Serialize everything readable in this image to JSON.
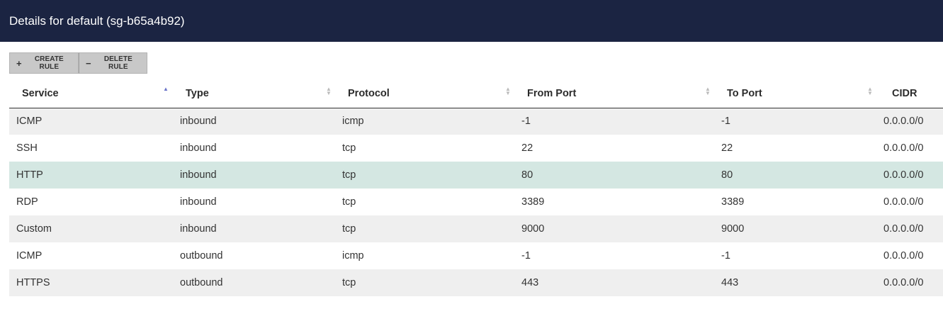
{
  "header": {
    "title": "Details for default (sg-b65a4b92)"
  },
  "toolbar": {
    "create_label": "Create Rule",
    "create_icon": "plus-icon",
    "delete_label": "Delete Rule",
    "delete_icon": "minus-icon"
  },
  "table": {
    "columns": [
      "Service",
      "Type",
      "Protocol",
      "From Port",
      "To Port",
      "CIDR"
    ],
    "sort": {
      "column": "Service",
      "direction": "ascending"
    },
    "rows": [
      {
        "service": "ICMP",
        "type": "inbound",
        "protocol": "icmp",
        "from_port": "-1",
        "to_port": "-1",
        "cidr": "0.0.0.0/0"
      },
      {
        "service": "SSH",
        "type": "inbound",
        "protocol": "tcp",
        "from_port": "22",
        "to_port": "22",
        "cidr": "0.0.0.0/0"
      },
      {
        "service": "HTTP",
        "type": "inbound",
        "protocol": "tcp",
        "from_port": "80",
        "to_port": "80",
        "cidr": "0.0.0.0/0",
        "selected": true
      },
      {
        "service": "RDP",
        "type": "inbound",
        "protocol": "tcp",
        "from_port": "3389",
        "to_port": "3389",
        "cidr": "0.0.0.0/0"
      },
      {
        "service": "Custom",
        "type": "inbound",
        "protocol": "tcp",
        "from_port": "9000",
        "to_port": "9000",
        "cidr": "0.0.0.0/0"
      },
      {
        "service": "ICMP",
        "type": "outbound",
        "protocol": "icmp",
        "from_port": "-1",
        "to_port": "-1",
        "cidr": "0.0.0.0/0"
      },
      {
        "service": "HTTPS",
        "type": "outbound",
        "protocol": "tcp",
        "from_port": "443",
        "to_port": "443",
        "cidr": "0.0.0.0/0"
      }
    ]
  },
  "colors": {
    "header_bg": "#1b2442",
    "row_stripe": "#efefef",
    "row_selected": "#d4e7e2",
    "sort_active": "#6b74c9"
  }
}
